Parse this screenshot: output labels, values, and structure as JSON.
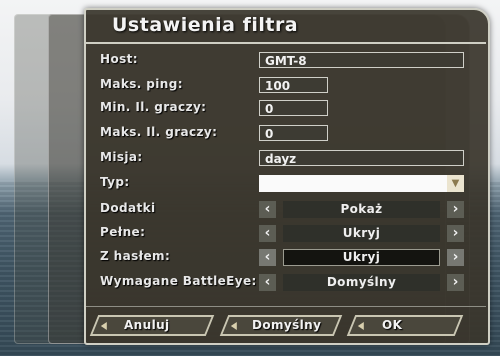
{
  "dialog": {
    "title": "Ustawienia filtra"
  },
  "fields": {
    "host": {
      "label": "Host:",
      "value": "GMT-8"
    },
    "max_ping": {
      "label": "Maks. ping:",
      "value": "100"
    },
    "min_players": {
      "label": "Min. Il. graczy:",
      "value": "0"
    },
    "max_players": {
      "label": "Maks. Il. graczy:",
      "value": "0"
    },
    "mission": {
      "label": "Misja:",
      "value": "dayz"
    },
    "type": {
      "label": "Typ:",
      "value": ""
    }
  },
  "selectors": {
    "addons": {
      "label": "Dodatki",
      "value": "Pokaż"
    },
    "full": {
      "label": "Pełne:",
      "value": "Ukryj"
    },
    "password": {
      "label": "Z hasłem:",
      "value": "Ukryj"
    },
    "battleye": {
      "label": "Wymagane BattleEye:",
      "value": "Domyślny"
    }
  },
  "buttons": {
    "cancel": "Anuluj",
    "default": "Domyślny",
    "ok": "OK"
  },
  "icons": {
    "left_arrow": "chevron-left-icon",
    "right_arrow": "chevron-right-icon",
    "dropdown": "chevron-down-icon",
    "button_marker": "triangle-left-icon"
  }
}
